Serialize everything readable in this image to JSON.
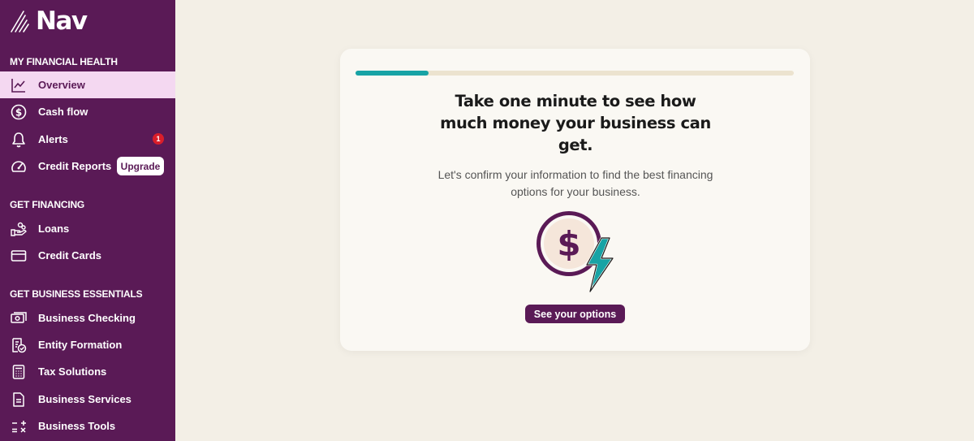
{
  "app": {
    "logo_text": "Nav"
  },
  "sidebar": {
    "sections": [
      {
        "title": "MY FINANCIAL HEALTH"
      },
      {
        "title": "GET FINANCING"
      },
      {
        "title": "GET BUSINESS ESSENTIALS"
      }
    ],
    "items": [
      {
        "label": "Overview",
        "icon": "chart-line-icon",
        "active": true
      },
      {
        "label": "Cash flow",
        "icon": "dollar-circle-icon"
      },
      {
        "label": "Alerts",
        "icon": "bell-icon",
        "badge": "1"
      },
      {
        "label": "Credit Reports",
        "icon": "gauge-icon",
        "button": "Upgrade"
      },
      {
        "label": "Loans",
        "icon": "hand-coins-icon"
      },
      {
        "label": "Credit Cards",
        "icon": "credit-card-icon"
      },
      {
        "label": "Business Checking",
        "icon": "cash-icon"
      },
      {
        "label": "Entity Formation",
        "icon": "document-check-icon"
      },
      {
        "label": "Tax Solutions",
        "icon": "calculator-icon"
      },
      {
        "label": "Business Services",
        "icon": "document-icon"
      },
      {
        "label": "Business Tools",
        "icon": "math-tools-icon"
      }
    ]
  },
  "main": {
    "progress": 0.167,
    "title": "Take one minute to see how much money your business can get.",
    "subtitle": "Let's confirm your information to find the best financing options for your business.",
    "cta_label": "See your options"
  },
  "colors": {
    "sidebar_bg": "#5a1a56",
    "active_bg": "#f4d8f1",
    "accent_teal": "#17a3a5",
    "badge_red": "#d91e2a",
    "page_bg": "#f3efe6"
  }
}
